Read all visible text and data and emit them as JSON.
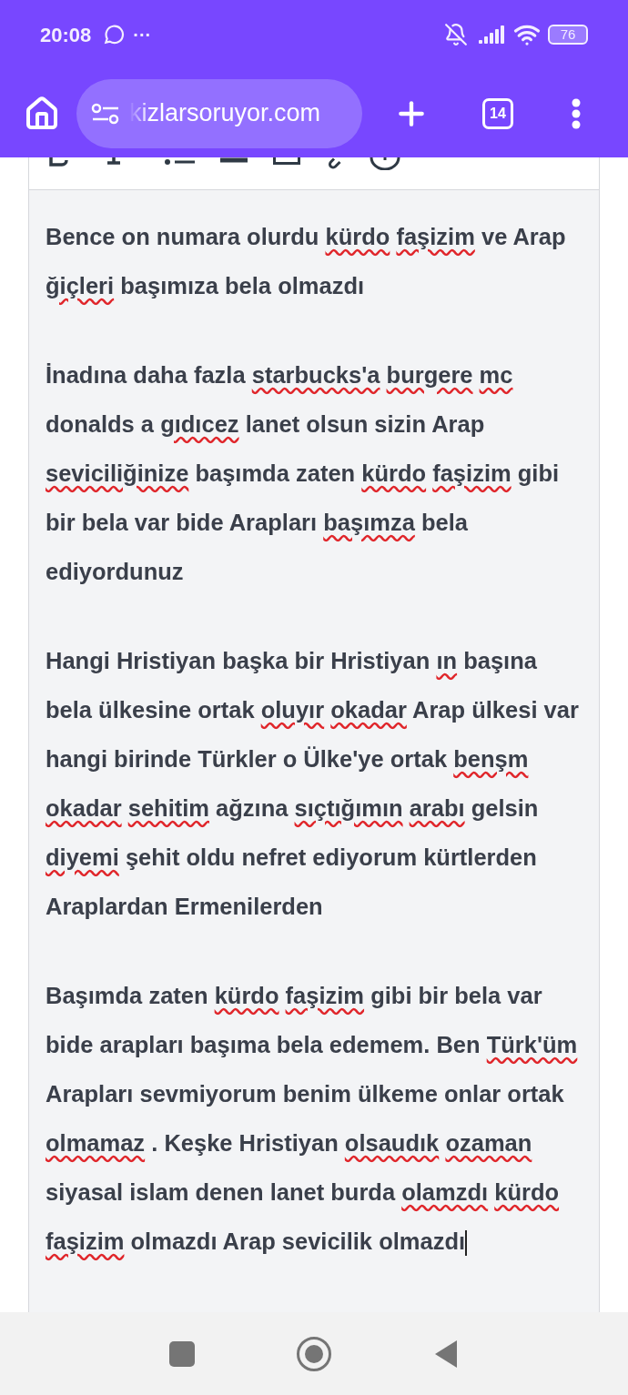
{
  "status_bar": {
    "time": "20:08",
    "more": "···",
    "battery": "76"
  },
  "browser": {
    "url": "kizlarsoruyor.com",
    "tab_count": "14"
  },
  "editor": {
    "caret": true,
    "paragraphs": [
      {
        "segments": [
          {
            "text": "Bence on numara olurdu",
            "misspelled": false
          },
          {
            "text": "kürdo",
            "misspelled": true
          },
          {
            "text": "faşizim",
            "misspelled": true
          },
          {
            "text": "ve Arap",
            "misspelled": false
          },
          {
            "text": "ğiçleri",
            "misspelled": true
          },
          {
            "text": "başımıza bela olmazdı",
            "misspelled": false
          }
        ]
      },
      {
        "segments": [
          {
            "text": "İnadına daha fazla",
            "misspelled": false
          },
          {
            "text": "starbucks'a",
            "misspelled": true
          },
          {
            "text": "burgere",
            "misspelled": true
          },
          {
            "text": "mc",
            "misspelled": true
          },
          {
            "text": "donalds a",
            "misspelled": false
          },
          {
            "text": "gıdıcez",
            "misspelled": true
          },
          {
            "text": "lanet olsun sizin Arap",
            "misspelled": false
          },
          {
            "text": "seviciliğinize",
            "misspelled": true
          },
          {
            "text": "başımda zaten",
            "misspelled": false
          },
          {
            "text": "kürdo",
            "misspelled": true
          },
          {
            "text": "faşizim",
            "misspelled": true
          },
          {
            "text": "gibi bir bela var bide Arapları",
            "misspelled": false
          },
          {
            "text": "başımza",
            "misspelled": true
          },
          {
            "text": "bela ediyordunuz",
            "misspelled": false
          }
        ]
      },
      {
        "segments": [
          {
            "text": "Hangi Hristiyan başka bir Hristiyan",
            "misspelled": false
          },
          {
            "text": "ın",
            "misspelled": true
          },
          {
            "text": "başına bela ülkesine ortak",
            "misspelled": false
          },
          {
            "text": "oluyır",
            "misspelled": true
          },
          {
            "text": "okadar",
            "misspelled": true
          },
          {
            "text": "Arap ülkesi var hangi birinde Türkler o Ülke'ye ortak",
            "misspelled": false
          },
          {
            "text": "benşm",
            "misspelled": true
          },
          {
            "text": "okadar",
            "misspelled": true
          },
          {
            "text": "sehitim",
            "misspelled": true
          },
          {
            "text": "ağzına",
            "misspelled": false
          },
          {
            "text": "sıçtığımın",
            "misspelled": true
          },
          {
            "text": "arabı",
            "misspelled": true
          },
          {
            "text": "gelsin",
            "misspelled": false
          },
          {
            "text": "diyemi",
            "misspelled": true
          },
          {
            "text": "şehit oldu nefret ediyorum kürtlerden Araplardan Ermenilerden",
            "misspelled": false
          }
        ]
      },
      {
        "segments": [
          {
            "text": "Başımda zaten",
            "misspelled": false
          },
          {
            "text": "kürdo",
            "misspelled": true
          },
          {
            "text": "faşizim",
            "misspelled": true
          },
          {
            "text": "gibi bir bela var bide arapları başıma bela edemem. Ben",
            "misspelled": false
          },
          {
            "text": "Türk'üm",
            "misspelled": true
          },
          {
            "text": "Arapları sevmiyorum benim ülkeme onlar ortak",
            "misspelled": false
          },
          {
            "text": "olmamaz",
            "misspelled": true
          },
          {
            "text": ". Keşke Hristiyan",
            "misspelled": false
          },
          {
            "text": "olsaudık",
            "misspelled": true
          },
          {
            "text": "ozaman",
            "misspelled": true
          },
          {
            "text": "siyasal islam denen lanet burda",
            "misspelled": false
          },
          {
            "text": "olamzdı",
            "misspelled": true
          },
          {
            "text": "kürdo",
            "misspelled": true
          },
          {
            "text": "faşizim",
            "misspelled": true
          },
          {
            "text": "olmazdı Arap sevicilik olmazdı",
            "misspelled": false
          }
        ]
      }
    ]
  }
}
